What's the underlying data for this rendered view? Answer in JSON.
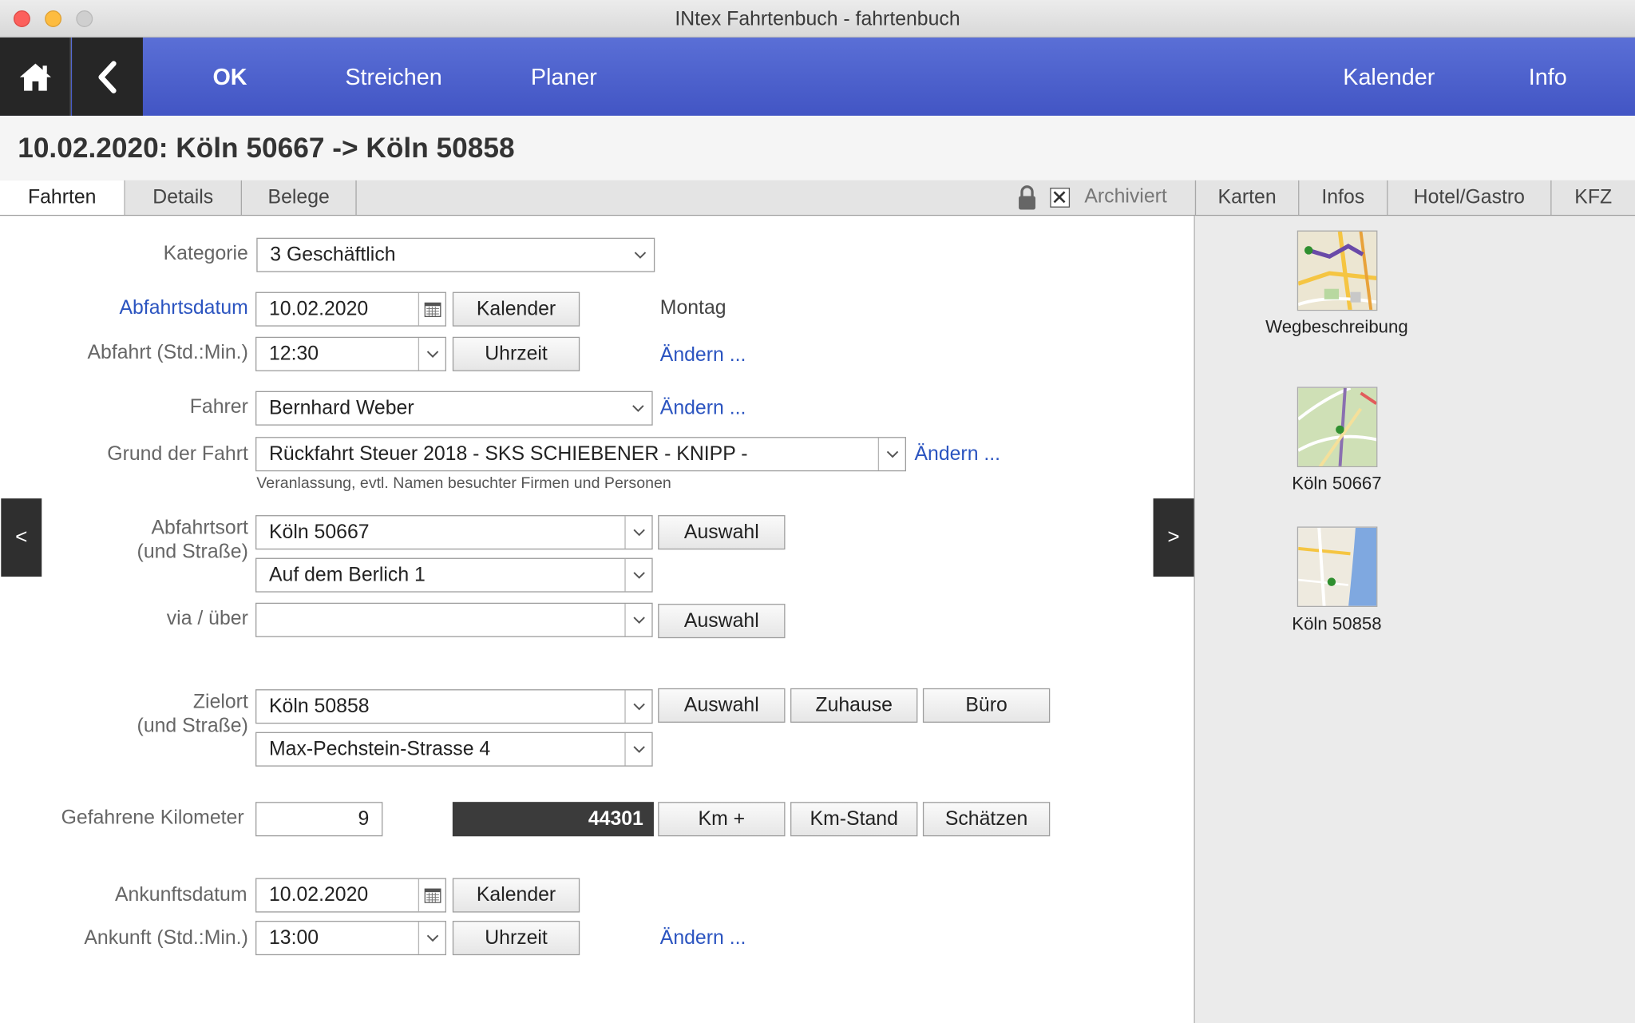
{
  "window": {
    "title": "INtex Fahrtenbuch - fahrtenbuch"
  },
  "toolbar": {
    "ok": "OK",
    "streichen": "Streichen",
    "planer": "Planer",
    "kalender": "Kalender",
    "info": "Info"
  },
  "header": {
    "title": "10.02.2020: Köln 50667 -> Köln 50858"
  },
  "tabs": {
    "left": [
      "Fahrten",
      "Details",
      "Belege"
    ],
    "archived_label": "Archiviert",
    "right": [
      "Karten",
      "Infos",
      "Hotel/Gastro",
      "KFZ"
    ]
  },
  "form": {
    "kategorie": {
      "label": "Kategorie",
      "value": "3 Geschäftlich"
    },
    "abfahrtsdatum": {
      "label": "Abfahrtsdatum",
      "value": "10.02.2020",
      "button": "Kalender",
      "weekday": "Montag"
    },
    "abfahrt": {
      "label": "Abfahrt (Std.:Min.)",
      "value": "12:30",
      "button": "Uhrzeit",
      "link": "Ändern ..."
    },
    "fahrer": {
      "label": "Fahrer",
      "value": "Bernhard Weber",
      "link": "Ändern ..."
    },
    "grund": {
      "label": "Grund der Fahrt",
      "value": "Rückfahrt Steuer 2018 - SKS SCHIEBENER - KNIPP -",
      "link": "Ändern ...",
      "hint": "Veranlassung, evtl. Namen besuchter Firmen und Personen"
    },
    "abfahrtsort": {
      "label1": "Abfahrtsort",
      "label2": "(und Straße)",
      "value": "Köln 50667",
      "street": "Auf dem Berlich 1",
      "button": "Auswahl"
    },
    "via": {
      "label": "via / über",
      "value": "",
      "button": "Auswahl"
    },
    "zielort": {
      "label1": "Zielort",
      "label2": "(und Straße)",
      "value": "Köln 50858",
      "street": "Max-Pechstein-Strasse 4",
      "button": "Auswahl",
      "zuhause": "Zuhause",
      "buero": "Büro"
    },
    "km": {
      "label": "Gefahrene Kilometer",
      "value": "9",
      "stand": "44301",
      "km_plus": "Km +",
      "km_stand": "Km-Stand",
      "schaetzen": "Schätzen"
    },
    "ankunftsdatum": {
      "label": "Ankunftsdatum",
      "value": "10.02.2020",
      "button": "Kalender"
    },
    "ankunft": {
      "label": "Ankunft (Std.:Min.)",
      "value": "13:00",
      "button": "Uhrzeit",
      "link": "Ändern ..."
    }
  },
  "nav": {
    "prev": "<",
    "next": ">"
  },
  "side": {
    "maps": [
      {
        "label": "Wegbeschreibung"
      },
      {
        "label": "Köln 50667"
      },
      {
        "label": "Köln 50858"
      }
    ]
  }
}
